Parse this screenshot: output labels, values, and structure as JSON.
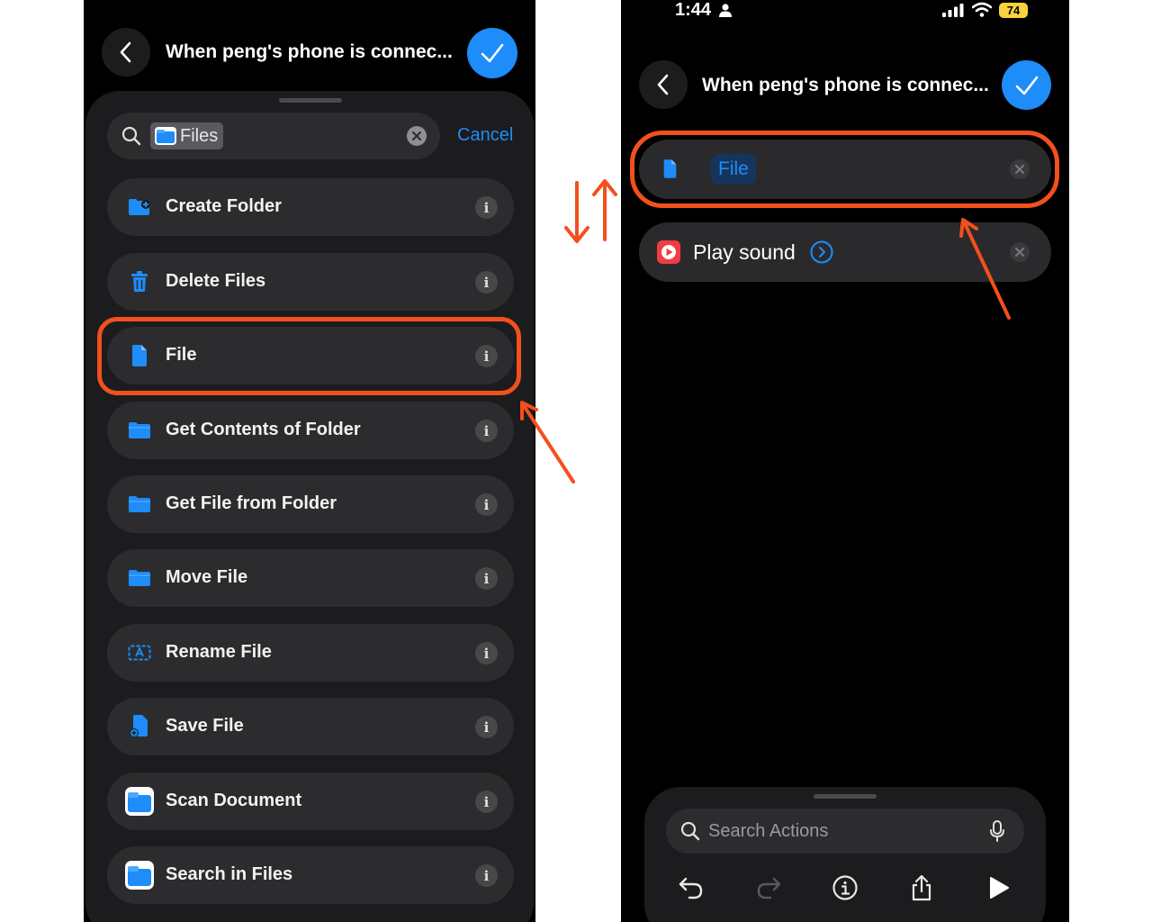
{
  "left_screen": {
    "header": {
      "title": "When peng's phone is connec...",
      "done_color": "#1e8cf9"
    },
    "search": {
      "token_label": "Files",
      "cancel_label": "Cancel"
    },
    "actions": [
      {
        "label": "Create Folder",
        "icon": "folder-add-icon"
      },
      {
        "label": "Delete Files",
        "icon": "trash-icon"
      },
      {
        "label": "File",
        "icon": "document-icon"
      },
      {
        "label": "Get Contents of Folder",
        "icon": "folder-icon"
      },
      {
        "label": "Get File from Folder",
        "icon": "folder-icon"
      },
      {
        "label": "Move File",
        "icon": "folder-icon"
      },
      {
        "label": "Rename File",
        "icon": "rename-icon"
      },
      {
        "label": "Save File",
        "icon": "save-file-icon"
      },
      {
        "label": "Scan Document",
        "icon": "files-app-icon"
      },
      {
        "label": "Search in Files",
        "icon": "files-app-icon"
      }
    ],
    "info_label": "i",
    "highlighted_action": "File"
  },
  "right_screen": {
    "status_bar": {
      "time": "1:44",
      "battery": "74"
    },
    "header": {
      "title": "When peng's phone is connec..."
    },
    "steps": [
      {
        "label": "File",
        "icon": "document-icon",
        "highlighted": true
      },
      {
        "label": "Play sound",
        "icon": "play-sound-icon"
      }
    ],
    "bottom_bar": {
      "search_placeholder": "Search Actions"
    }
  },
  "colors": {
    "accent": "#1e8cf9",
    "annotation": "#f2501c",
    "sound_red": "#f23c45"
  }
}
